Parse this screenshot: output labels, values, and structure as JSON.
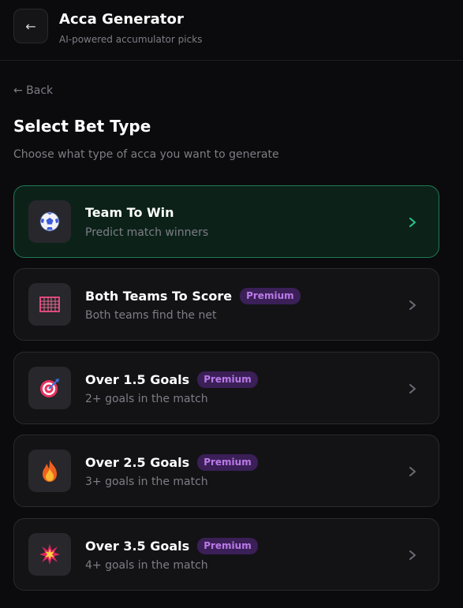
{
  "header": {
    "back_icon": "←",
    "title": "Acca Generator",
    "subtitle": "AI-powered accumulator picks"
  },
  "nav": {
    "back_label": "← Back"
  },
  "page": {
    "title": "Select Bet Type",
    "subtitle": "Choose what type of acca you want to generate"
  },
  "bet_types": [
    {
      "title": "Team To Win",
      "description": "Predict match winners",
      "icon": "soccer-ball-icon",
      "badge": "",
      "selected": true
    },
    {
      "title": "Both Teams To Score",
      "description": "Both teams find the net",
      "icon": "goal-net-icon",
      "badge": "Premium",
      "selected": false
    },
    {
      "title": "Over 1.5 Goals",
      "description": "2+ goals in the match",
      "icon": "target-icon",
      "badge": "Premium",
      "selected": false
    },
    {
      "title": "Over 2.5 Goals",
      "description": "3+ goals in the match",
      "icon": "fire-icon",
      "badge": "Premium",
      "selected": false
    },
    {
      "title": "Over 3.5 Goals",
      "description": "4+ goals in the match",
      "icon": "explosion-icon",
      "badge": "Premium",
      "selected": false
    }
  ],
  "colors": {
    "background": "#0b0b0d",
    "card": "#131316",
    "selected_border": "#1f7a55",
    "selected_chevron": "#2ec48a",
    "premium_badge_bg": "#3b1f57",
    "premium_badge_text": "#b97ae8",
    "muted_text": "#7d7d85"
  }
}
